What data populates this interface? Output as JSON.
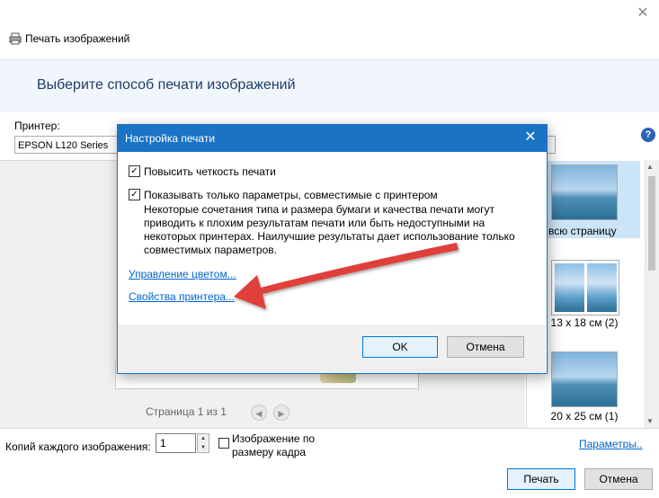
{
  "window": {
    "title": "Печать изображений",
    "close_glyph": "✕"
  },
  "header": {
    "text": "Выберите способ печати изображений"
  },
  "options_row": {
    "printer_label": "Принтер:",
    "printer_value": "EPSON L120 Series",
    "help_glyph": "?"
  },
  "preview": {
    "page_indicator": "Страница 1 из 1",
    "prev_glyph": "◀",
    "next_glyph": "▶"
  },
  "layouts": [
    {
      "label": "Во всю страницу",
      "selected": true
    },
    {
      "label": "13 x 18 см (2)",
      "selected": false
    },
    {
      "label": "20 x 25 см (1)",
      "selected": false
    }
  ],
  "bottom": {
    "copies_label": "Копий каждого изображения:",
    "copies_value": "1",
    "fit_label": "Изображение по размеру кадра",
    "fit_checked": false,
    "options_link": "Параметры..",
    "print_button": "Печать",
    "cancel_button": "Отмена"
  },
  "dialog": {
    "title": "Настройка печати",
    "close_glyph": "✕",
    "sharpen_label": "Повысить четкость печати",
    "sharpen_checked": true,
    "compat_label": "Показывать только параметры, совместимые с принтером",
    "compat_checked": true,
    "compat_description": "Некоторые сочетания типа и размера бумаги и качества печати могут приводить к плохим результатам печати или быть недоступными на некоторых принтерах. Наилучшие результаты дает использование только совместимых параметров.",
    "color_management_link": "Управление цветом...",
    "printer_properties_link": "Свойства принтера...",
    "ok_button": "OK",
    "cancel_button": "Отмена",
    "check_glyph": "✓"
  },
  "colors": {
    "dialog_accent": "#1a73c4",
    "link": "#0066cc",
    "arrow": "#e0403a"
  }
}
